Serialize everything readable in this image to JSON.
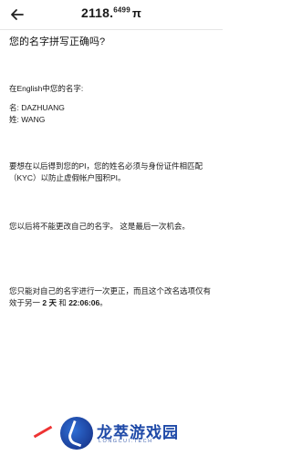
{
  "header": {
    "balance_int": "2118.",
    "balance_dec": "6499",
    "currency": "π"
  },
  "main": {
    "question": "您的名字拼写正确吗?",
    "label": "在English中您的名字:",
    "first_name": "名: DAZHUANG",
    "last_name": "姓: WANG",
    "para1": "要想在以后得到您的PI，您的姓名必须与身份证件相匹配（KYC）以防止虚假帐户囤积PI。",
    "para2": "您以后将不能更改自己的名字。 这是最后一次机会。",
    "para3_prefix": "您只能对自己的名字进行一次更正，而且这个改名选项仅有效于另一 ",
    "para3_days": "2 天",
    "para3_and": " 和 ",
    "para3_time": "22:06:06",
    "para3_suffix": "。"
  },
  "watermark": {
    "brand": "龙萃游戏园",
    "brand_sub": "LONGCUI.TECH"
  },
  "colors": {
    "background": "#ffffff",
    "text": "#1a1a1a",
    "brand": "#1f4aa8"
  }
}
